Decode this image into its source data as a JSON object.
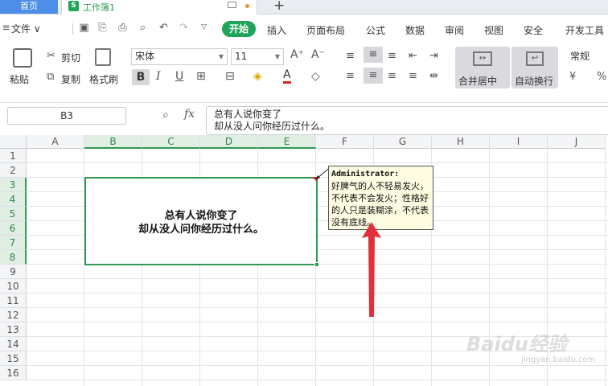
{
  "tabs": {
    "home": "首页",
    "workbook": "工作簿1",
    "sheet_icon": "S"
  },
  "menu": {
    "file": "文件",
    "start": "开始",
    "items": [
      "插入",
      "页面布局",
      "公式",
      "数据",
      "审阅",
      "视图",
      "安全",
      "开发工具"
    ]
  },
  "ribbon": {
    "paste": "粘贴",
    "cut": "剪切",
    "copy": "复制",
    "format_painter": "格式刷",
    "font_name": "宋体",
    "font_size": "11",
    "merge_center": "合并居中",
    "wrap_text": "自动换行",
    "number_format": "常规"
  },
  "formula_bar": {
    "cell_ref": "B3",
    "fx": "fx",
    "line1": "总有人说你变了",
    "line2": "却从没人问你经历过什么。"
  },
  "grid": {
    "columns": [
      "A",
      "B",
      "C",
      "D",
      "E",
      "F",
      "G",
      "H",
      "I",
      "J"
    ],
    "rows": [
      "1",
      "2",
      "3",
      "4",
      "5",
      "6",
      "7",
      "8",
      "9",
      "10",
      "11",
      "12",
      "13",
      "14",
      "15",
      "16"
    ],
    "selected_columns": [
      "B",
      "C",
      "D",
      "E"
    ],
    "selected_rows": [
      "3",
      "4",
      "5",
      "6",
      "7",
      "8"
    ]
  },
  "cell": {
    "line1": "总有人说你变了",
    "line2": "却从没人问你经历过什么。"
  },
  "comment": {
    "author": "Administrator:",
    "text": "好脾气的人不轻易发火，不代表不会发火；性格好的人只是装糊涂，不代表没有底线。"
  },
  "watermark": {
    "main": "Baidu经验",
    "sub": "jingyan.baidu.com"
  },
  "colors": {
    "accent_green": "#1fa45a",
    "comment_bg": "#fffde1",
    "arrow_red": "#e0303a"
  }
}
